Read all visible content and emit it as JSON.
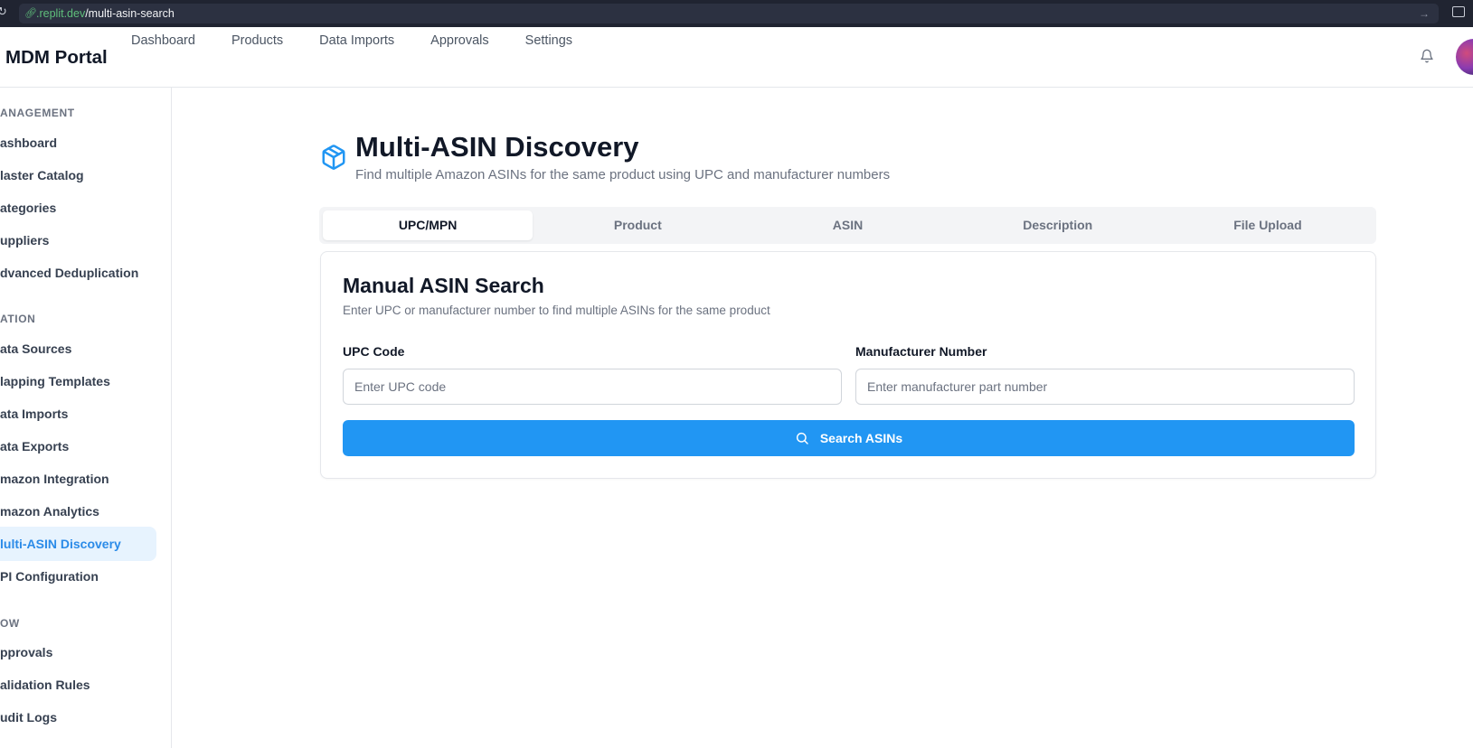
{
  "browser": {
    "url_domain": ".replit.dev",
    "url_path": "/multi-asin-search"
  },
  "header": {
    "brand": "MDM Portal",
    "nav": [
      "Dashboard",
      "Products",
      "Data Imports",
      "Approvals",
      "Settings"
    ]
  },
  "sidebar": {
    "sections": [
      {
        "title": "ANAGEMENT",
        "items": [
          "ashboard",
          "laster Catalog",
          "ategories",
          "uppliers",
          "dvanced Deduplication"
        ]
      },
      {
        "title": "ATION",
        "items": [
          "ata Sources",
          "lapping Templates",
          "ata Imports",
          "ata Exports",
          "mazon Integration",
          "mazon Analytics",
          "lulti-ASIN Discovery",
          "PI Configuration"
        ]
      },
      {
        "title": "OW",
        "items": [
          "pprovals",
          "alidation Rules",
          "udit Logs"
        ]
      }
    ],
    "active_item": "lulti-ASIN Discovery"
  },
  "main": {
    "title": "Multi-ASIN Discovery",
    "subtitle": "Find multiple Amazon ASINs for the same product using UPC and manufacturer numbers",
    "tabs": [
      "UPC/MPN",
      "Product",
      "ASIN",
      "Description",
      "File Upload"
    ],
    "active_tab": "UPC/MPN",
    "card": {
      "title": "Manual ASIN Search",
      "description": "Enter UPC or manufacturer number to find multiple ASINs for the same product",
      "upc_label": "UPC Code",
      "upc_placeholder": "Enter UPC code",
      "mpn_label": "Manufacturer Number",
      "mpn_placeholder": "Enter manufacturer part number",
      "button_label": "Search ASINs"
    }
  },
  "colors": {
    "accent": "#2196f3",
    "active_bg": "#e7f3fe",
    "active_text": "#2b8be8"
  }
}
